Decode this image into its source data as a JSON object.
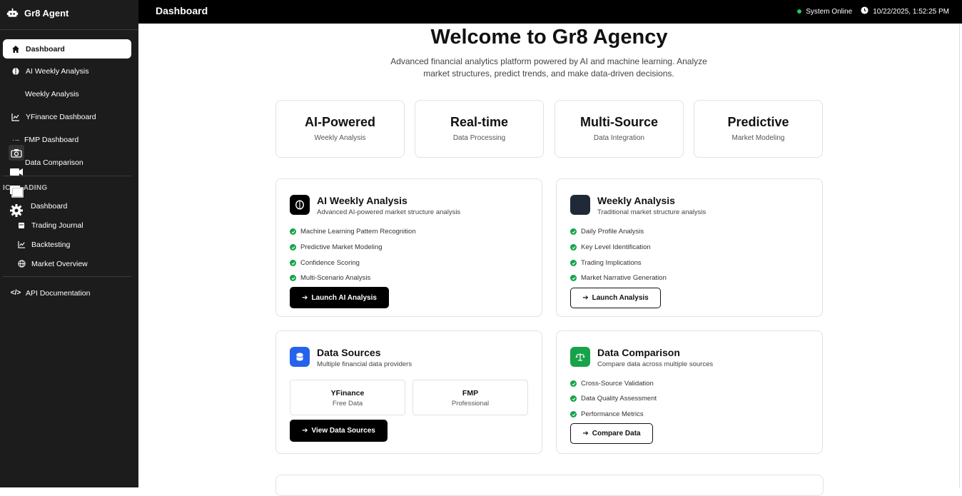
{
  "app": {
    "name": "Gr8 Agent",
    "page_title": "Dashboard"
  },
  "sidebar": {
    "items": [
      {
        "label": "Dashboard",
        "icon": "home-icon"
      },
      {
        "label": "AI Weekly Analysis",
        "icon": "brain-icon"
      },
      {
        "label": "Weekly Analysis",
        "icon": ""
      },
      {
        "label": "YFinance Dashboard",
        "icon": "chart-line-icon"
      },
      {
        "label": "FMP Dashboard",
        "icon": "dots-icon"
      },
      {
        "label": "Data Comparison",
        "icon": ""
      }
    ],
    "section_label": "IC      ADING",
    "trading_items": [
      {
        "label": "Dashboard",
        "icon": ""
      },
      {
        "label": "Trading Journal",
        "icon": "journal-icon"
      },
      {
        "label": "Backtesting",
        "icon": "chart-line-icon"
      },
      {
        "label": "Market Overview",
        "icon": "globe-icon"
      }
    ],
    "footer_item": {
      "label": "API Documentation",
      "icon": "code-icon"
    }
  },
  "topbar": {
    "status": "System Online",
    "datetime": "10/22/2025, 1:52:25 PM",
    "status_color": "#22c55e"
  },
  "hero": {
    "title": "Welcome to Gr8 Agency",
    "subtitle": "Advanced financial analytics platform powered by AI and machine learning. Analyze market structures, predict trends, and make data-driven decisions."
  },
  "stats": [
    {
      "value": "AI-Powered",
      "label": "Weekly Analysis"
    },
    {
      "value": "Real-time",
      "label": "Data Processing"
    },
    {
      "value": "Multi-Source",
      "label": "Data Integration"
    },
    {
      "value": "Predictive",
      "label": "Market Modeling"
    }
  ],
  "cards": {
    "ai_weekly": {
      "title": "AI Weekly Analysis",
      "desc": "Advanced AI-powered market structure analysis",
      "features": [
        "Machine Learning Pattern Recognition",
        "Predictive Market Modeling",
        "Confidence Scoring",
        "Multi-Scenario Analysis"
      ],
      "button": "Launch AI Analysis"
    },
    "weekly": {
      "title": "Weekly Analysis",
      "desc": "Traditional market structure analysis",
      "features": [
        "Daily Profile Analysis",
        "Key Level Identification",
        "Trading Implications",
        "Market Narrative Generation"
      ],
      "button": "Launch Analysis"
    },
    "sources": {
      "title": "Data Sources",
      "desc": "Multiple financial data providers",
      "sources": [
        {
          "name": "YFinance",
          "desc": "Free Data"
        },
        {
          "name": "FMP",
          "desc": "Professional"
        }
      ],
      "button": "View Data Sources"
    },
    "comparison": {
      "title": "Data Comparison",
      "desc": "Compare data across multiple sources",
      "features": [
        "Cross-Source Validation",
        "Data Quality Assessment",
        "Performance Metrics"
      ],
      "button": "Compare Data"
    }
  },
  "colors": {
    "sidebar_bg": "#1c1c1c",
    "topbar_bg": "#000000",
    "check_green": "#16a34a",
    "sources_blue": "#2563eb",
    "comparison_green": "#16a34a",
    "weekly_icon": "#1f2937"
  }
}
